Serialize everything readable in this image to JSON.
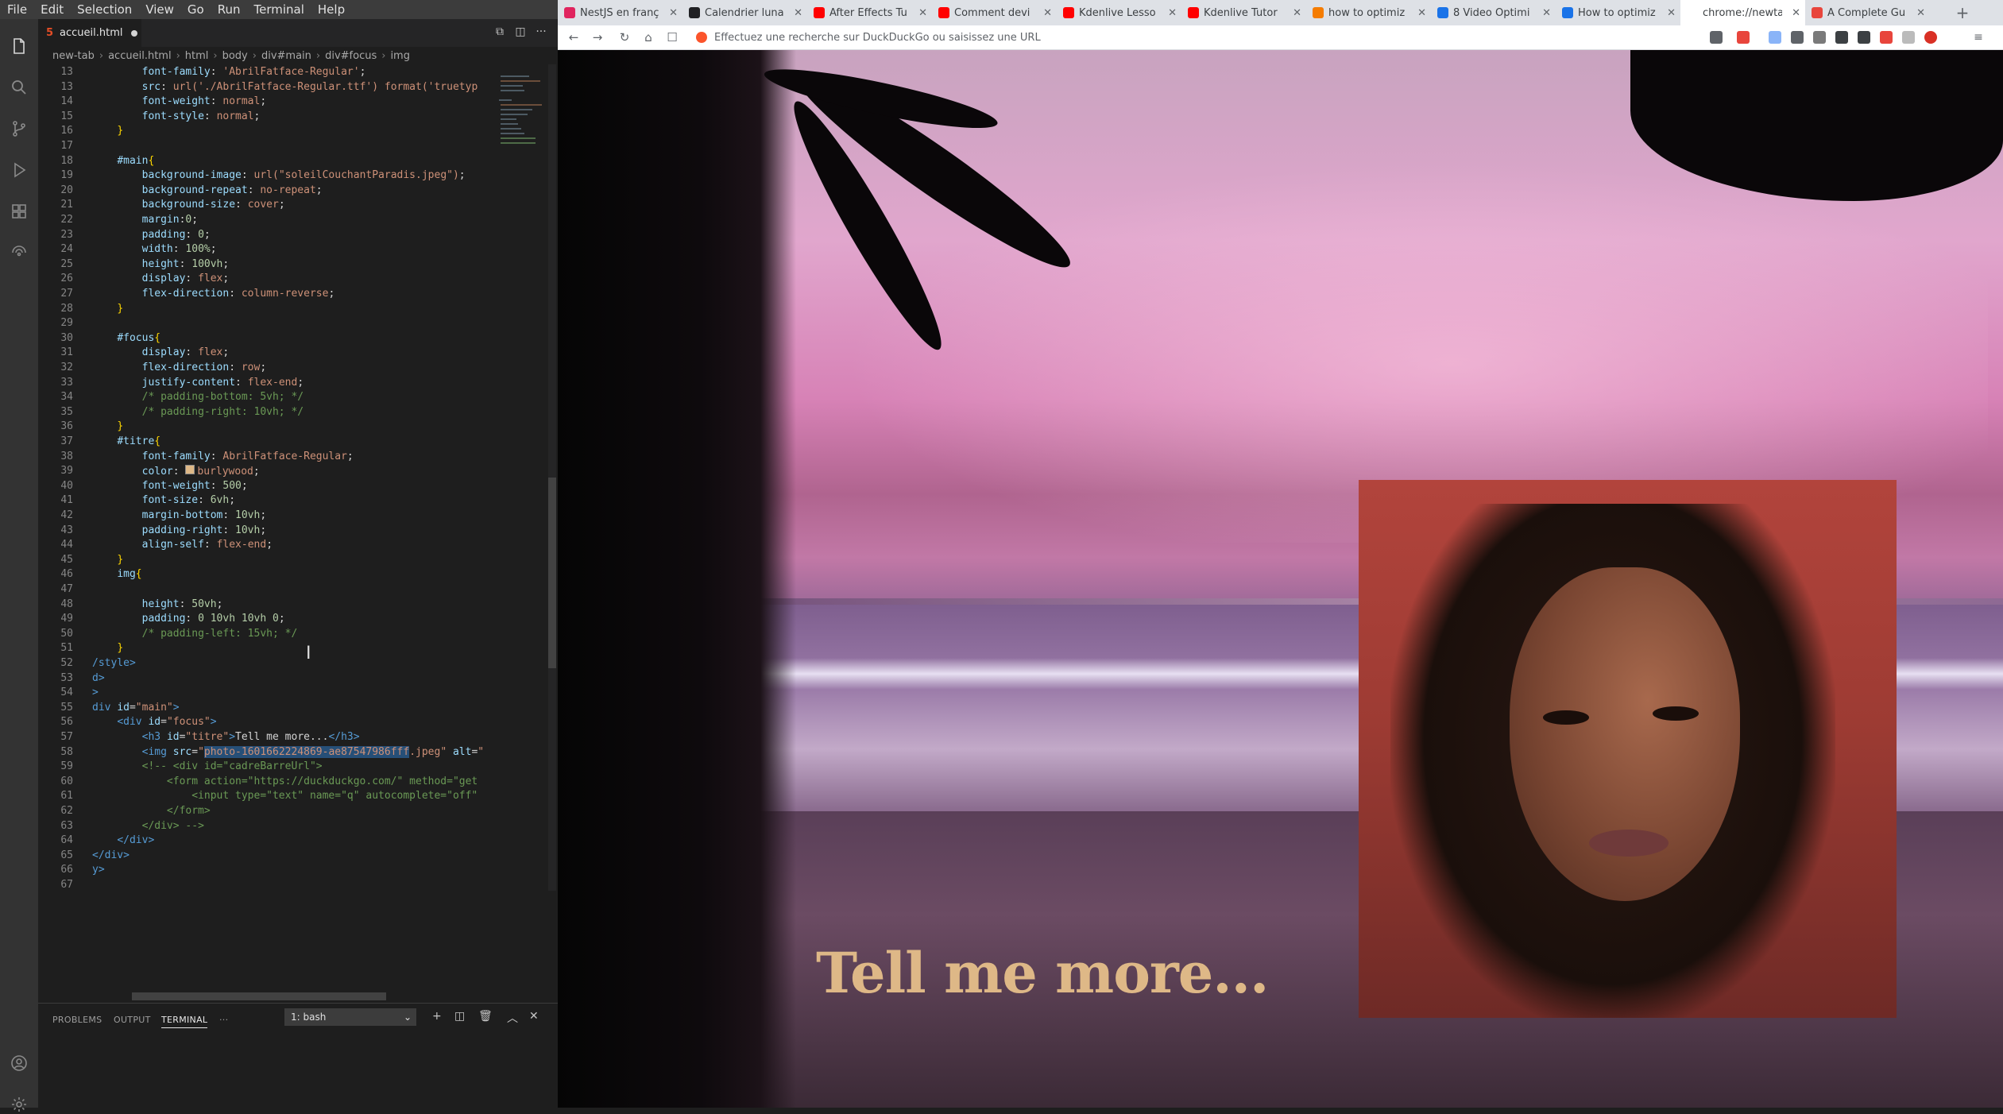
{
  "editor": {
    "menu": [
      "File",
      "Edit",
      "Selection",
      "View",
      "Go",
      "Run",
      "Terminal",
      "Help"
    ],
    "tab_filename": "accueil.html",
    "breadcrumb": [
      "new-tab",
      "accueil.html",
      "html",
      "body",
      "div#main",
      "div#focus",
      "img"
    ],
    "code_lines": [
      {
        "n": "13",
        "html": "        <span class='prop'>font-family</span>: <span class='val'>'AbrilFatface-Regular'</span>;"
      },
      {
        "n": "13",
        "html": "        <span class='prop'>src</span>: <span class='val'>url('./AbrilFatface-Regular.ttf') format('truetyp</span>"
      },
      {
        "n": "14",
        "html": "        <span class='prop'>font-weight</span>: <span class='val'>normal</span>;"
      },
      {
        "n": "15",
        "html": "        <span class='prop'>font-style</span>: <span class='val'>normal</span>;"
      },
      {
        "n": "16",
        "html": "    <span class='brace'>}</span>"
      },
      {
        "n": "17",
        "html": ""
      },
      {
        "n": "18",
        "html": "    <span class='sel'>#main</span><span class='brace'>{</span>"
      },
      {
        "n": "19",
        "html": "        <span class='prop'>background-image</span>: <span class='val'>url(\"soleilCouchantParadis.jpeg\")</span>;"
      },
      {
        "n": "20",
        "html": "        <span class='prop'>background-repeat</span>: <span class='val'>no-repeat</span>;"
      },
      {
        "n": "21",
        "html": "        <span class='prop'>background-size</span>: <span class='val'>cover</span>;"
      },
      {
        "n": "22",
        "html": "        <span class='prop'>margin</span>:<span class='num'>0</span>;"
      },
      {
        "n": "23",
        "html": "        <span class='prop'>padding</span>: <span class='num'>0</span>;"
      },
      {
        "n": "24",
        "html": "        <span class='prop'>width</span>: <span class='num'>100%</span>;"
      },
      {
        "n": "25",
        "html": "        <span class='prop'>height</span>: <span class='num'>100vh</span>;"
      },
      {
        "n": "26",
        "html": "        <span class='prop'>display</span>: <span class='val'>flex</span>;"
      },
      {
        "n": "27",
        "html": "        <span class='prop'>flex-direction</span>: <span class='val'>column-reverse</span>;"
      },
      {
        "n": "28",
        "html": "    <span class='brace'>}</span>"
      },
      {
        "n": "29",
        "html": ""
      },
      {
        "n": "30",
        "html": "    <span class='sel'>#focus</span><span class='brace'>{</span>"
      },
      {
        "n": "31",
        "html": "        <span class='prop'>display</span>: <span class='val'>flex</span>;"
      },
      {
        "n": "32",
        "html": "        <span class='prop'>flex-direction</span>: <span class='val'>row</span>;"
      },
      {
        "n": "33",
        "html": "        <span class='prop'>justify-content</span>: <span class='val'>flex-end</span>;"
      },
      {
        "n": "34",
        "html": "        <span class='cmt'>/* padding-bottom: 5vh; */</span>"
      },
      {
        "n": "35",
        "html": "        <span class='cmt'>/* padding-right: 10vh; */</span>"
      },
      {
        "n": "36",
        "html": "    <span class='brace'>}</span>"
      },
      {
        "n": "37",
        "html": "    <span class='sel'>#titre</span><span class='brace'>{</span>"
      },
      {
        "n": "38",
        "html": "        <span class='prop'>font-family</span>: <span class='val'>AbrilFatface-Regular</span>;"
      },
      {
        "n": "39",
        "html": "        <span class='prop'>color</span>: <span style='display:inline-block;width:10px;height:10px;background:#deb887;border:1px solid #888;margin-right:3px'></span><span class='val'>burlywood</span>;"
      },
      {
        "n": "40",
        "html": "        <span class='prop'>font-weight</span>: <span class='num'>500</span>;"
      },
      {
        "n": "41",
        "html": "        <span class='prop'>font-size</span>: <span class='num'>6vh</span>;"
      },
      {
        "n": "42",
        "html": "        <span class='prop'>margin-bottom</span>: <span class='num'>10vh</span>;"
      },
      {
        "n": "43",
        "html": "        <span class='prop'>padding-right</span>: <span class='num'>10vh</span>;"
      },
      {
        "n": "44",
        "html": "        <span class='prop'>align-self</span>: <span class='val'>flex-end</span>;"
      },
      {
        "n": "45",
        "html": "    <span class='brace'>}</span>"
      },
      {
        "n": "46",
        "html": "    <span class='sel'>img</span><span class='brace'>{</span>"
      },
      {
        "n": "47",
        "html": ""
      },
      {
        "n": "48",
        "html": "        <span class='prop'>height</span>: <span class='num'>50vh</span>;"
      },
      {
        "n": "49",
        "html": "        <span class='prop'>padding</span>: <span class='num'>0 10vh 10vh 0</span>;"
      },
      {
        "n": "50",
        "html": "        <span class='cmt'>/* padding-left: 15vh; */</span>"
      },
      {
        "n": "51",
        "html": "    <span class='brace'>}</span>"
      },
      {
        "n": "52",
        "html": "<span class='tag'>/style&gt;</span>"
      },
      {
        "n": "53",
        "html": "<span class='tag'>d&gt;</span>"
      },
      {
        "n": "54",
        "html": "<span class='tag'>&gt;</span>"
      },
      {
        "n": "55",
        "html": "<span class='tag'>div</span> <span class='attr'>id</span>=<span class='str'>\"main\"</span><span class='tag'>&gt;</span>"
      },
      {
        "n": "56",
        "html": "    <span class='tag'>&lt;div</span> <span class='attr'>id</span>=<span class='str'>\"focus\"</span><span class='tag'>&gt;</span>"
      },
      {
        "n": "57",
        "html": "        <span class='tag'>&lt;h3</span> <span class='attr'>id</span>=<span class='str'>\"titre\"</span><span class='tag'>&gt;</span>Tell me more...<span class='tag'>&lt;/h3&gt;</span>"
      },
      {
        "n": "58",
        "html": "        <span class='tag'>&lt;img</span> <span class='attr'>src</span>=<span class='str'>\"<span class='hl'>photo-1601662224869-ae87547986fff</span>.jpeg\"</span> <span class='attr'>alt</span>=<span class='str'>\"</span>"
      },
      {
        "n": "59",
        "html": "        <span class='cmt'>&lt;!-- &lt;div id=\"cadreBarreUrl\"&gt;</span>"
      },
      {
        "n": "60",
        "html": "            <span class='cmt'>&lt;form action=\"https://duckduckgo.com/\" method=\"get</span>"
      },
      {
        "n": "61",
        "html": "                <span class='cmt'>&lt;input type=\"text\" name=\"q\" autocomplete=\"off\"</span>"
      },
      {
        "n": "62",
        "html": "            <span class='cmt'>&lt;/form&gt;</span>"
      },
      {
        "n": "63",
        "html": "        <span class='cmt'>&lt;/div&gt; --&gt;</span>"
      },
      {
        "n": "64",
        "html": "    <span class='tag'>&lt;/div&gt;</span>"
      },
      {
        "n": "65",
        "html": "<span class='tag'>&lt;/div&gt;</span>"
      },
      {
        "n": "66",
        "html": "<span class='tag'>y&gt;</span>"
      },
      {
        "n": "67",
        "html": ""
      }
    ],
    "panel_tabs": [
      "PROBLEMS",
      "OUTPUT",
      "TERMINAL",
      "···"
    ],
    "terminal_select": "1: bash"
  },
  "browser": {
    "tabs": [
      {
        "label": "NestJS en franç",
        "color": "#e0245e"
      },
      {
        "label": "Calendrier luna",
        "color": "#202124"
      },
      {
        "label": "After Effects Tu",
        "color": "#ff0000"
      },
      {
        "label": "Comment devi",
        "color": "#ff0000"
      },
      {
        "label": "Kdenlive Lesso",
        "color": "#ff0000"
      },
      {
        "label": "Kdenlive Tutor",
        "color": "#ff0000"
      },
      {
        "label": "how to optimiz",
        "color": "#f57c00"
      },
      {
        "label": "8 Video Optimi",
        "color": "#1a73e8"
      },
      {
        "label": "How to optimiz",
        "color": "#1a73e8"
      },
      {
        "label": "chrome://newtab",
        "color": "#ffffff"
      },
      {
        "label": "A Complete Gu",
        "color": "#e8453c"
      }
    ],
    "address_placeholder": "Effectuez une recherche sur DuckDuckGo ou saisissez une URL"
  },
  "page": {
    "title": "Tell me more..."
  }
}
